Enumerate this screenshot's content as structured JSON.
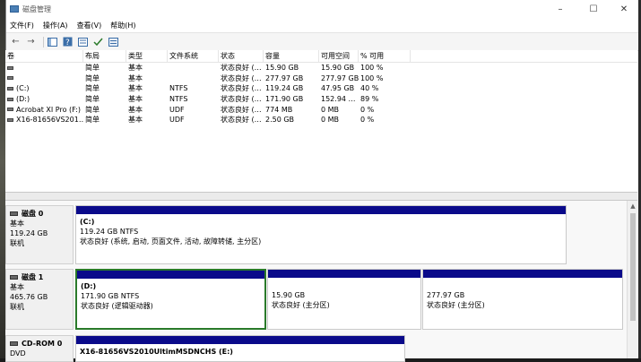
{
  "window": {
    "title": "磁盘管理"
  },
  "menu": [
    "文件(F)",
    "操作(A)",
    "查看(V)",
    "帮助(H)"
  ],
  "window_controls": {
    "minimize": "–",
    "maximize": "☐",
    "close": "✕"
  },
  "volume_table": {
    "headers": [
      "卷",
      "布局",
      "类型",
      "文件系统",
      "状态",
      "容量",
      "可用空间",
      "% 可用"
    ],
    "rows": [
      [
        "",
        "简单",
        "基本",
        "",
        "状态良好 (…",
        "15.90 GB",
        "15.90 GB",
        "100 %"
      ],
      [
        "",
        "简单",
        "基本",
        "",
        "状态良好 (…",
        "277.97 GB",
        "277.97 GB",
        "100 %"
      ],
      [
        "(C:)",
        "简单",
        "基本",
        "NTFS",
        "状态良好 (…",
        "119.24 GB",
        "47.95 GB",
        "40 %"
      ],
      [
        "(D:)",
        "简单",
        "基本",
        "NTFS",
        "状态良好 (…",
        "171.90 GB",
        "152.94 …",
        "89 %"
      ],
      [
        "Acrobat XI Pro (F:)",
        "简单",
        "基本",
        "UDF",
        "状态良好 (…",
        "774 MB",
        "0 MB",
        "0 %"
      ],
      [
        "X16-81656VS201…",
        "简单",
        "基本",
        "UDF",
        "状态良好 (…",
        "2.50 GB",
        "0 MB",
        "0 %"
      ]
    ]
  },
  "disks": [
    {
      "name": "磁盘 0",
      "type": "基本",
      "size": "119.24 GB",
      "status": "联机",
      "partitions": [
        {
          "title": "(C:)",
          "line1": "119.24 GB NTFS",
          "line2": "状态良好 (系统, 启动, 页面文件, 活动, 故障转储, 主分区)"
        }
      ]
    },
    {
      "name": "磁盘 1",
      "type": "基本",
      "size": "465.76 GB",
      "status": "联机",
      "partitions": [
        {
          "title": "(D:)",
          "line1": "171.90 GB NTFS",
          "line2": "状态良好 (逻辑驱动器)"
        },
        {
          "title": "",
          "line1": "15.90 GB",
          "line2": "状态良好 (主分区)"
        },
        {
          "title": "",
          "line1": "277.97 GB",
          "line2": "状态良好 (主分区)"
        }
      ]
    },
    {
      "name": "CD-ROM 0",
      "type": "DVD",
      "size": "",
      "status": "",
      "partitions": [
        {
          "title": "X16-81656VS2010UltimMSDNCHS (E:)",
          "line1": "",
          "line2": ""
        }
      ]
    }
  ],
  "colors": {
    "partition_bar": "#0a0a8a",
    "selected_border": "#2a7a2a"
  }
}
